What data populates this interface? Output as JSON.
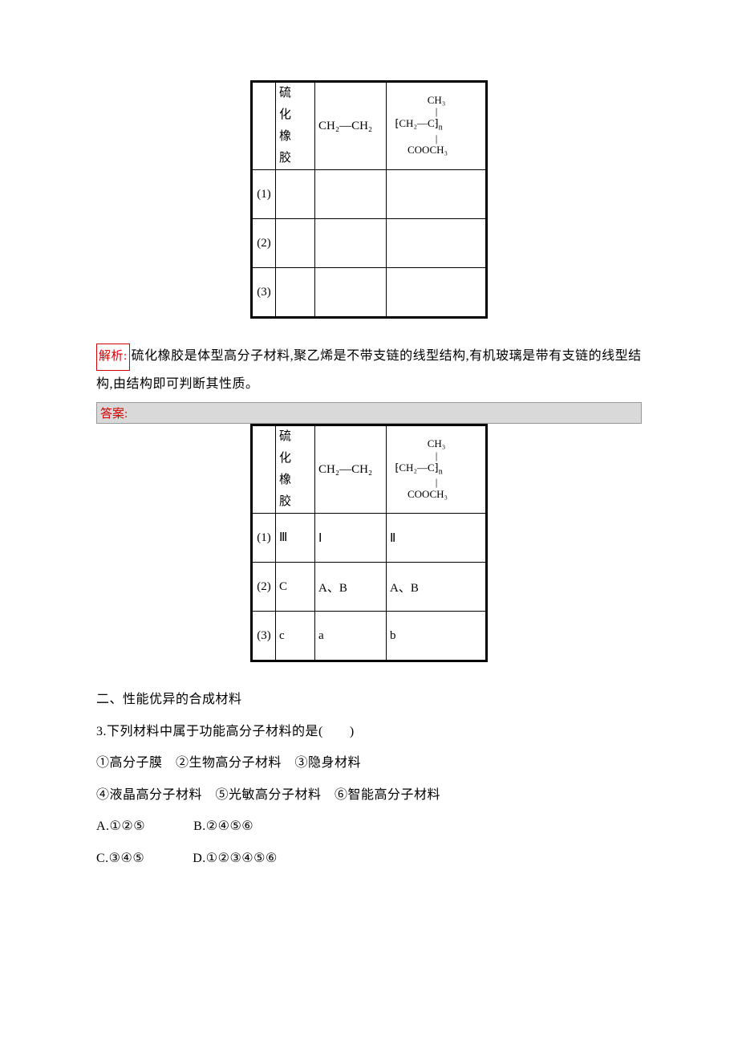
{
  "table1": {
    "header": {
      "c2": "硫化橡胶",
      "c3": "CH₂—CH₂",
      "c4_line1": "CH₃",
      "c4_line2": "|",
      "c4_line3_left": "⁅CH₂—C⁆",
      "c4_line3_sub": "n",
      "c4_line4": "|",
      "c4_line5": "COOCH₃"
    },
    "rows": [
      {
        "c1": "(1)",
        "c2": "",
        "c3": "",
        "c4": ""
      },
      {
        "c1": "(2)",
        "c2": "",
        "c3": "",
        "c4": ""
      },
      {
        "c1": "(3)",
        "c2": "",
        "c3": "",
        "c4": ""
      }
    ]
  },
  "explain": {
    "tag": "解析:",
    "text": "硫化橡胶是体型高分子材料,聚乙烯是不带支链的线型结构,有机玻璃是带有支链的线型结构,由结构即可判断其性质。"
  },
  "answer_tag": "答案:",
  "table2": {
    "header": {
      "c2": "硫化橡胶",
      "c3": "CH₂—CH₂",
      "c4_line1": "CH₃",
      "c4_line2": "|",
      "c4_line3_left": "⁅CH₂—C⁆",
      "c4_line3_sub": "n",
      "c4_line4": "|",
      "c4_line5": "COOCH₃"
    },
    "rows": [
      {
        "c1": "(1)",
        "c2": "Ⅲ",
        "c3": "Ⅰ",
        "c4": "Ⅱ"
      },
      {
        "c1": "(2)",
        "c2": "C",
        "c3": "A、B",
        "c4": "A、B"
      },
      {
        "c1": "(3)",
        "c2": "c",
        "c3": "a",
        "c4": "b"
      }
    ]
  },
  "section2_heading": "二、性能优异的合成材料",
  "q3": {
    "stem": "3.下列材料中属于功能高分子材料的是(　　)",
    "line2": "①高分子膜　②生物高分子材料　③隐身材料",
    "line3": "④液晶高分子材料　⑤光敏高分子材料　⑥智能高分子材料",
    "optA": "A.①②⑤",
    "optB": "B.②④⑤⑥",
    "optC": "C.③④⑤",
    "optD": "D.①②③④⑤⑥"
  }
}
